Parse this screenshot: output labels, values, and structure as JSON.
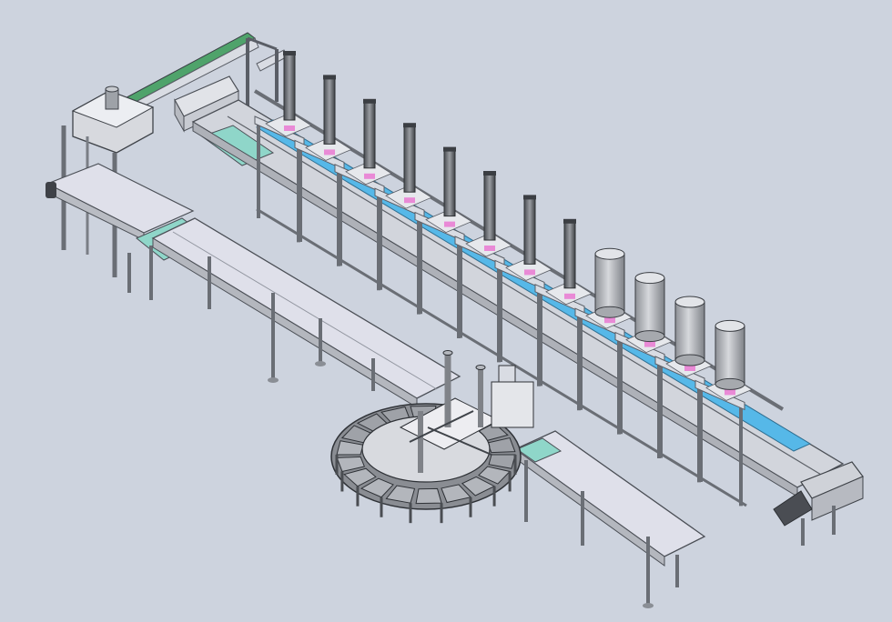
{
  "scene": {
    "background": "#cdd3de",
    "colors": {
      "frame": "#d9dce3",
      "frame_edge": "#5a5e66",
      "belt_blue": "#56b8e8",
      "belt_teal": "#8fd6c9",
      "rail_green": "#4fa36b",
      "deck": "#dfe0ea",
      "cylinder": "#b9bcc2",
      "accent_pink": "#e98ad6"
    },
    "counts": {
      "dosing_stations": 12,
      "carousel_pockets": 18
    }
  }
}
